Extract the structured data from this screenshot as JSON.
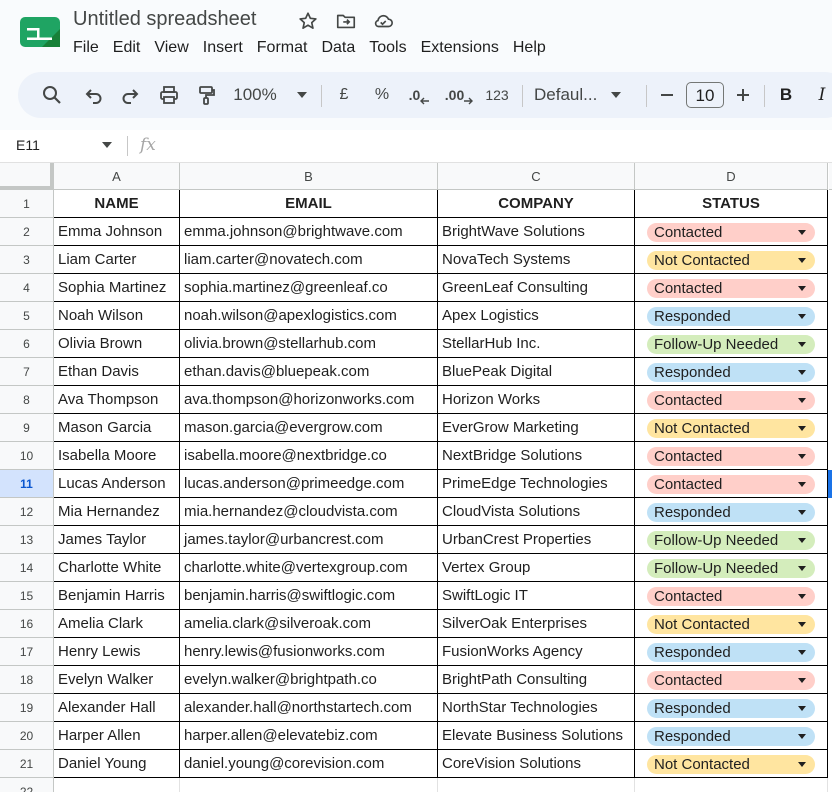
{
  "app": {
    "title": "Untitled spreadsheet",
    "menu": [
      "File",
      "Edit",
      "View",
      "Insert",
      "Format",
      "Data",
      "Tools",
      "Extensions",
      "Help"
    ]
  },
  "toolbar": {
    "zoom": "100%",
    "currency": "£",
    "percent": "%",
    "dec_decrease": ".0",
    "dec_increase": ".00",
    "number_format": "123",
    "font": "Defaul...",
    "font_size": "10",
    "bold": "B",
    "italic": "I"
  },
  "formula_bar": {
    "cell_ref": "E11",
    "fx": "fx",
    "value": ""
  },
  "sheet": {
    "columns": [
      "A",
      "B",
      "C",
      "D"
    ],
    "selected_row": 11,
    "headers": [
      "NAME",
      "EMAIL",
      "COMPANY",
      "STATUS"
    ],
    "rows": [
      {
        "name": "Emma Johnson",
        "email": "emma.johnson@brightwave.com",
        "company": "BrightWave Solutions",
        "status": "Contacted"
      },
      {
        "name": "Liam Carter",
        "email": "liam.carter@novatech.com",
        "company": "NovaTech Systems",
        "status": "Not Contacted"
      },
      {
        "name": "Sophia Martinez",
        "email": "sophia.martinez@greenleaf.co",
        "company": "GreenLeaf Consulting",
        "status": "Contacted"
      },
      {
        "name": "Noah Wilson",
        "email": "noah.wilson@apexlogistics.com",
        "company": "Apex Logistics",
        "status": "Responded"
      },
      {
        "name": "Olivia Brown",
        "email": "olivia.brown@stellarhub.com",
        "company": "StellarHub Inc.",
        "status": "Follow-Up Needed"
      },
      {
        "name": "Ethan Davis",
        "email": "ethan.davis@bluepeak.com",
        "company": "BluePeak Digital",
        "status": "Responded"
      },
      {
        "name": "Ava Thompson",
        "email": "ava.thompson@horizonworks.com",
        "company": "Horizon Works",
        "status": "Contacted"
      },
      {
        "name": "Mason Garcia",
        "email": "mason.garcia@evergrow.com",
        "company": "EverGrow Marketing",
        "status": "Not Contacted"
      },
      {
        "name": "Isabella Moore",
        "email": "isabella.moore@nextbridge.co",
        "company": "NextBridge Solutions",
        "status": "Contacted"
      },
      {
        "name": "Lucas Anderson",
        "email": "lucas.anderson@primeedge.com",
        "company": "PrimeEdge Technologies",
        "status": "Contacted"
      },
      {
        "name": "Mia Hernandez",
        "email": "mia.hernandez@cloudvista.com",
        "company": "CloudVista Solutions",
        "status": "Responded"
      },
      {
        "name": "James Taylor",
        "email": "james.taylor@urbancrest.com",
        "company": "UrbanCrest Properties",
        "status": "Follow-Up Needed"
      },
      {
        "name": "Charlotte White",
        "email": "charlotte.white@vertexgroup.com",
        "company": "Vertex Group",
        "status": "Follow-Up Needed"
      },
      {
        "name": "Benjamin Harris",
        "email": "benjamin.harris@swiftlogic.com",
        "company": "SwiftLogic IT",
        "status": "Contacted"
      },
      {
        "name": "Amelia Clark",
        "email": "amelia.clark@silveroak.com",
        "company": "SilverOak Enterprises",
        "status": "Not Contacted"
      },
      {
        "name": "Henry Lewis",
        "email": "henry.lewis@fusionworks.com",
        "company": "FusionWorks Agency",
        "status": "Responded"
      },
      {
        "name": "Evelyn Walker",
        "email": "evelyn.walker@brightpath.co",
        "company": "BrightPath Consulting",
        "status": "Contacted"
      },
      {
        "name": "Alexander Hall",
        "email": "alexander.hall@northstartech.com",
        "company": "NorthStar Technologies",
        "status": "Responded"
      },
      {
        "name": "Harper Allen",
        "email": "harper.allen@elevatebiz.com",
        "company": "Elevate Business Solutions",
        "status": "Responded"
      },
      {
        "name": "Daniel Young",
        "email": "daniel.young@corevision.com",
        "company": "CoreVision Solutions",
        "status": "Not Contacted"
      }
    ],
    "status_colors": {
      "Contacted": "#ffcfc9",
      "Not Contacted": "#ffe5a0",
      "Responded": "#bfe1f6",
      "Follow-Up Needed": "#d4edbc"
    }
  }
}
